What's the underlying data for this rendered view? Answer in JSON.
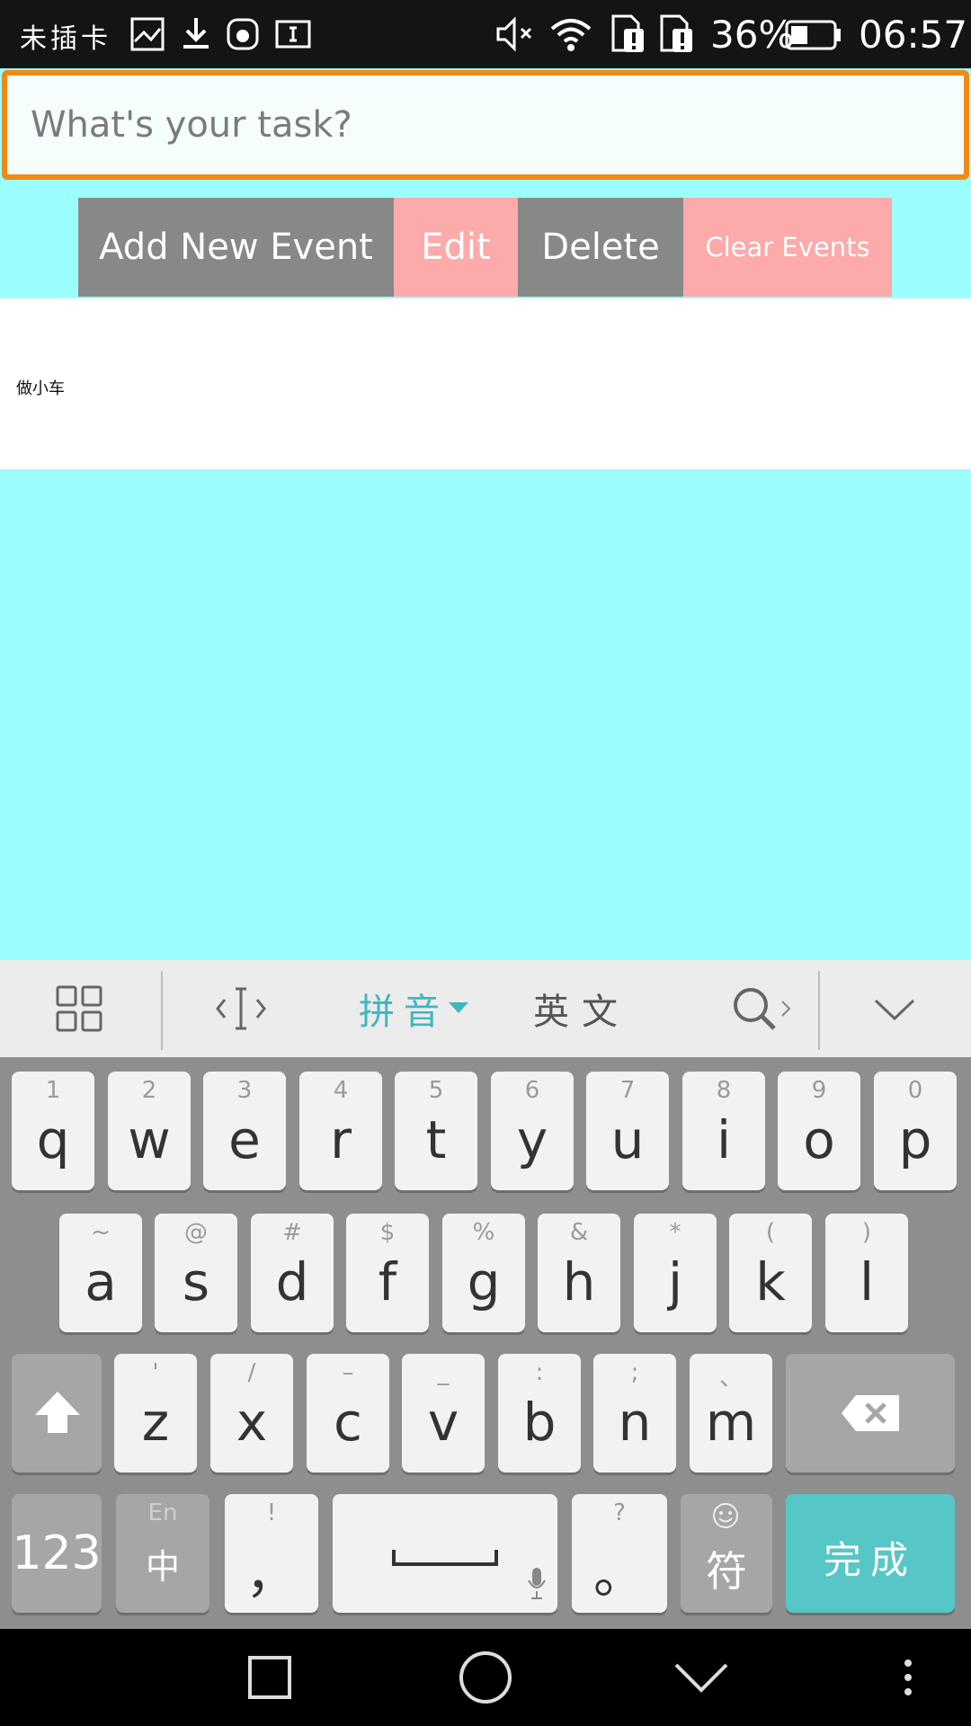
{
  "status_bar": {
    "carrier": "未插卡",
    "battery_percent": "36%",
    "time": "06:57",
    "icons": [
      "image-icon",
      "download-icon",
      "huawei-app-icon",
      "text-icon",
      "mute-icon",
      "wifi-icon",
      "sim1-alert-icon",
      "sim2-alert-icon",
      "battery-icon"
    ]
  },
  "task_input": {
    "placeholder": "What's your task?",
    "value": ""
  },
  "buttons": {
    "add": "Add New Event",
    "edit": "Edit",
    "delete": "Delete",
    "clear": "Clear Events"
  },
  "events": [
    "做小车"
  ],
  "colors": {
    "background": "#9cfefc",
    "input_border": "#ef8a17",
    "button_gray": "#888888",
    "button_pink": "#fcaaaa",
    "keyboard_accent": "#56c6c6"
  },
  "keyboard": {
    "toolbar": {
      "pinyin": "拼音",
      "english": "英文"
    },
    "row1": [
      {
        "main": "q",
        "sub": "1"
      },
      {
        "main": "w",
        "sub": "2"
      },
      {
        "main": "e",
        "sub": "3"
      },
      {
        "main": "r",
        "sub": "4"
      },
      {
        "main": "t",
        "sub": "5"
      },
      {
        "main": "y",
        "sub": "6"
      },
      {
        "main": "u",
        "sub": "7"
      },
      {
        "main": "i",
        "sub": "8"
      },
      {
        "main": "o",
        "sub": "9"
      },
      {
        "main": "p",
        "sub": "0"
      }
    ],
    "row2": [
      {
        "main": "a",
        "sub": "~"
      },
      {
        "main": "s",
        "sub": "@"
      },
      {
        "main": "d",
        "sub": "#"
      },
      {
        "main": "f",
        "sub": "$"
      },
      {
        "main": "g",
        "sub": "%"
      },
      {
        "main": "h",
        "sub": "&"
      },
      {
        "main": "j",
        "sub": "*"
      },
      {
        "main": "k",
        "sub": "("
      },
      {
        "main": "l",
        "sub": ")"
      }
    ],
    "row3": [
      {
        "main": "z",
        "sub": "'"
      },
      {
        "main": "x",
        "sub": "/"
      },
      {
        "main": "c",
        "sub": "–"
      },
      {
        "main": "v",
        "sub": "_"
      },
      {
        "main": "b",
        "sub": ":"
      },
      {
        "main": "n",
        "sub": ";"
      },
      {
        "main": "m",
        "sub": "、"
      }
    ],
    "bottom": {
      "numbers": "123",
      "lang_top": "En",
      "lang_bottom": "中",
      "comma_top": "!",
      "comma": "，",
      "period_top": "?",
      "period": "。",
      "symbols": "符",
      "done": "完成"
    }
  }
}
